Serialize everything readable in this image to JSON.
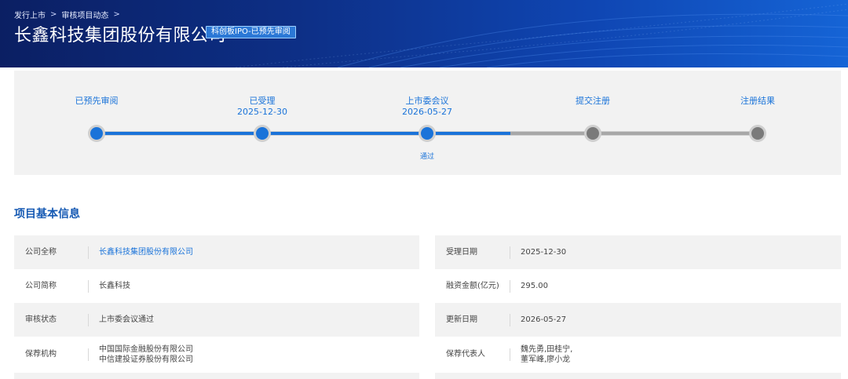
{
  "header": {
    "breadcrumb": [
      "发行上市",
      "审核项目动态"
    ],
    "company_title": "长鑫科技集团股份有限公司",
    "board_tag": "科创板IPO-已预先审阅"
  },
  "progress": {
    "steps": [
      {
        "label": "已预先审阅",
        "date": "",
        "active": true
      },
      {
        "label": "已受理",
        "date": "2025-12-30",
        "active": true
      },
      {
        "label": "上市委会议",
        "date": "2026-05-27",
        "active": true,
        "result": "通过"
      },
      {
        "label": "提交注册",
        "date": "",
        "active": false
      },
      {
        "label": "注册结果",
        "date": "",
        "active": false
      }
    ],
    "completed_fraction": 0.5
  },
  "basic_info": {
    "title": "项目基本信息",
    "left": [
      {
        "label": "公司全称",
        "value": [
          "长鑫科技集团股份有限公司"
        ],
        "link": true
      },
      {
        "label": "公司简称",
        "value": [
          "长鑫科技"
        ],
        "link": false
      },
      {
        "label": "审核状态",
        "value": [
          "上市委会议通过"
        ],
        "link": false
      },
      {
        "label": "保荐机构",
        "value": [
          "中国国际金融股份有限公司",
          "中信建投证券股份有限公司"
        ],
        "link": false
      }
    ],
    "right": [
      {
        "label": "受理日期",
        "value": [
          "2025-12-30"
        ]
      },
      {
        "label": "融资金额(亿元)",
        "value": [
          "295.00"
        ]
      },
      {
        "label": "更新日期",
        "value": [
          "2026-05-27"
        ]
      },
      {
        "label": "保荐代表人",
        "value": [
          "魏先勇,田桂宁,",
          "董军峰,廖小龙"
        ]
      }
    ]
  },
  "colors": {
    "accent": "#1a73d9",
    "title_blue": "#1559b3",
    "banner_dark": "#0b1f63",
    "banner_light": "#1564d6",
    "panel_gray": "#f2f2f2",
    "inactive_node": "#7a7a7a"
  }
}
